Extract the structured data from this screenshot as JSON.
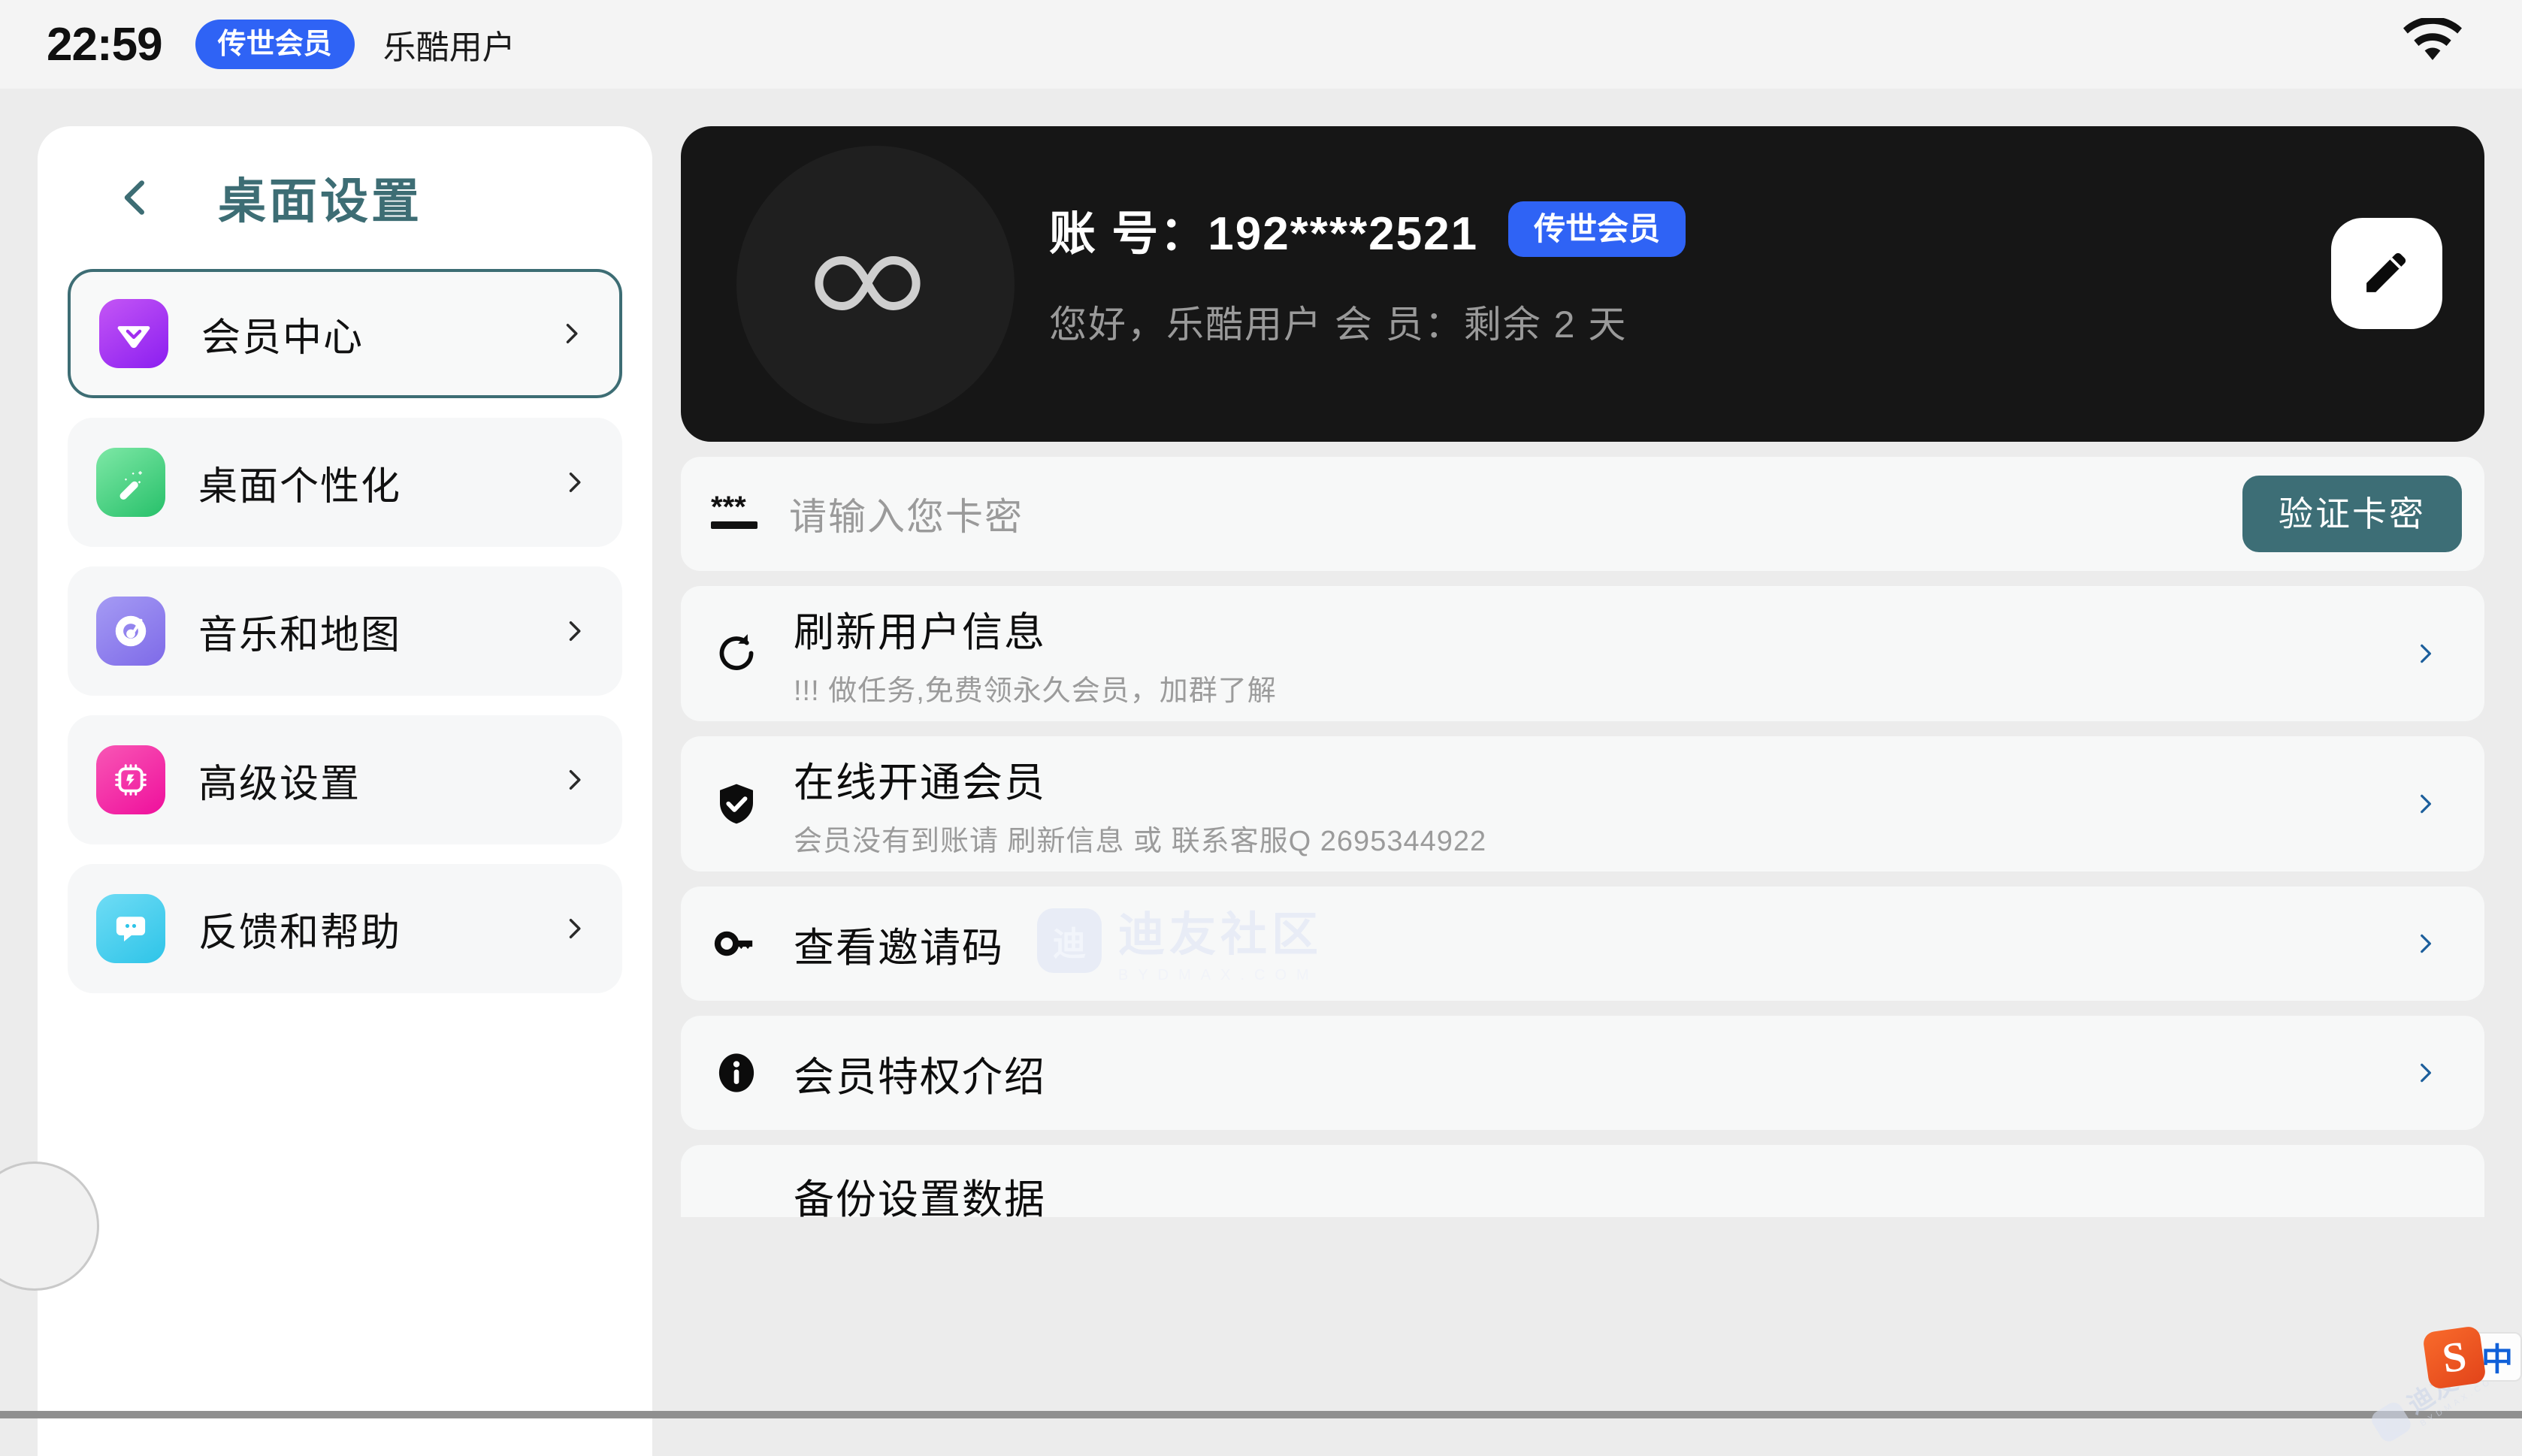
{
  "statusbar": {
    "clock": "22:59",
    "vip_badge": "传世会员",
    "username": "乐酷用户",
    "wifi_icon": "wifi-icon"
  },
  "sidebar": {
    "back_icon": "chevron-left-icon",
    "title": "桌面设置",
    "items": [
      {
        "label": "会员中心",
        "icon": "vip-heart-icon",
        "selected": true
      },
      {
        "label": "桌面个性化",
        "icon": "magic-wand-icon",
        "selected": false
      },
      {
        "label": "音乐和地图",
        "icon": "music-disc-icon",
        "selected": false
      },
      {
        "label": "高级设置",
        "icon": "chip-icon",
        "selected": false
      },
      {
        "label": "反馈和帮助",
        "icon": "chat-bubble-icon",
        "selected": false
      }
    ]
  },
  "profile": {
    "avatar_icon": "infinity-icon",
    "account_label": "账 号：192****2521",
    "vip_badge": "传世会员",
    "greeting": "您好，乐酷用户  会 员：剩余 2 天",
    "edit_icon": "pencil-icon"
  },
  "cardkey": {
    "icon": "password-asterisks-icon",
    "placeholder": "请输入您卡密",
    "value": "",
    "button_label": "验证卡密"
  },
  "menu": [
    {
      "icon": "refresh-icon",
      "title": "刷新用户信息",
      "sub": "!!! 做任务,免费领永久会员，加群了解",
      "chevron": "chevron-right-icon"
    },
    {
      "icon": "shield-check-icon",
      "title": "在线开通会员",
      "sub": "会员没有到账请 刷新信息 或 联系客服Q 2695344922",
      "chevron": "chevron-right-icon"
    },
    {
      "icon": "key-icon",
      "title": "查看邀请码",
      "sub": "",
      "chevron": "chevron-right-icon"
    },
    {
      "icon": "info-icon",
      "title": "会员特权介绍",
      "sub": "",
      "chevron": "chevron-right-icon"
    },
    {
      "icon": "",
      "title": "备份设置数据",
      "sub": "",
      "chevron": ""
    }
  ],
  "watermark": {
    "main": "迪友社区",
    "sub": "BYDMAX.COM",
    "mark": "迪"
  },
  "ime": {
    "logo": "S",
    "mode": "中"
  },
  "colors": {
    "accent_blue": "#2f63f5",
    "accent_teal": "#3d6e76",
    "card_dark": "#161616",
    "page_bg": "#ececec",
    "row_bg": "#f7f8f8"
  }
}
